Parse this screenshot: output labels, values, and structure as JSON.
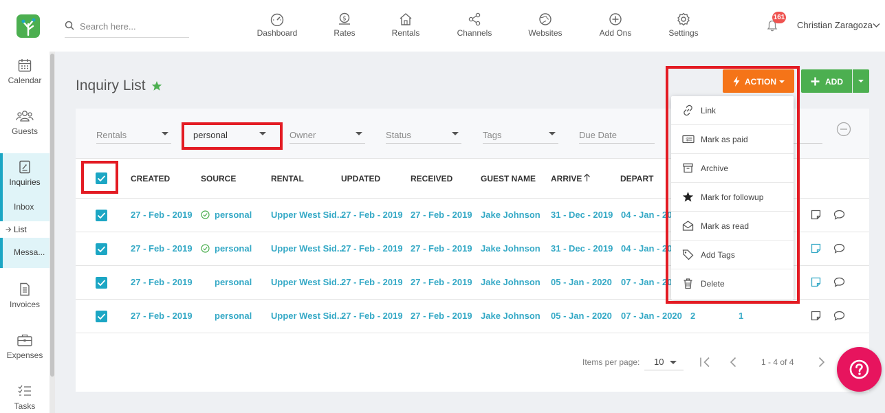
{
  "header": {
    "search_placeholder": "Search here...",
    "nav": [
      {
        "label": "Dashboard",
        "icon": "dashboard-icon"
      },
      {
        "label": "Rates",
        "icon": "rates-icon"
      },
      {
        "label": "Rentals",
        "icon": "home-icon"
      },
      {
        "label": "Channels",
        "icon": "share-icon"
      },
      {
        "label": "Websites",
        "icon": "globe-icon"
      },
      {
        "label": "Add Ons",
        "icon": "plus-circle-icon"
      },
      {
        "label": "Settings",
        "icon": "gear-icon"
      }
    ],
    "notification_count": "161",
    "user_name": "Christian Zaragoza"
  },
  "sidebar": {
    "items": [
      {
        "label": "Calendar",
        "icon": "calendar-icon"
      },
      {
        "label": "Guests",
        "icon": "guests-icon"
      },
      {
        "label": "Inquiries",
        "icon": "inquiries-icon"
      },
      {
        "label": "Invoices",
        "icon": "invoice-icon"
      },
      {
        "label": "Expenses",
        "icon": "briefcase-icon"
      },
      {
        "label": "Tasks",
        "icon": "tasks-icon"
      }
    ],
    "sub_items": [
      "Inbox",
      "List",
      "Messa..."
    ]
  },
  "page": {
    "title": "Inquiry List",
    "action_label": "ACTION",
    "add_label": "ADD"
  },
  "filters": [
    {
      "label": "Rentals"
    },
    {
      "label": "personal"
    },
    {
      "label": "Owner"
    },
    {
      "label": "Status"
    },
    {
      "label": "Tags"
    },
    {
      "label": "Due Date"
    }
  ],
  "table": {
    "columns": [
      "CREATED",
      "SOURCE",
      "RENTAL",
      "UPDATED",
      "RECEIVED",
      "GUEST NAME",
      "ARRIVE",
      "DEPART"
    ],
    "rows": [
      {
        "created": "27 - Feb - 2019",
        "source": "personal",
        "rental": "Upper West Sid...",
        "updated": "27 - Feb - 2019",
        "received": "27 - Feb - 2019",
        "guest": "Jake Johnson",
        "arrive": "31 - Dec - 2019",
        "depart": "04 - Jan - 20",
        "extra1": "",
        "extra2": ""
      },
      {
        "created": "27 - Feb - 2019",
        "source": "personal",
        "rental": "Upper West Sid...",
        "updated": "27 - Feb - 2019",
        "received": "27 - Feb - 2019",
        "guest": "Jake Johnson",
        "arrive": "31 - Dec - 2019",
        "depart": "04 - Jan - 20",
        "extra1": "",
        "extra2": ""
      },
      {
        "created": "27 - Feb - 2019",
        "source": "personal",
        "rental": "Upper West Sid...",
        "updated": "27 - Feb - 2019",
        "received": "27 - Feb - 2019",
        "guest": "Jake Johnson",
        "arrive": "05 - Jan - 2020",
        "depart": "07 - Jan - 20",
        "extra1": "",
        "extra2": ""
      },
      {
        "created": "27 - Feb - 2019",
        "source": "personal",
        "rental": "Upper West Sid...",
        "updated": "27 - Feb - 2019",
        "received": "27 - Feb - 2019",
        "guest": "Jake Johnson",
        "arrive": "05 - Jan - 2020",
        "depart": "07 - Jan - 2020",
        "extra1": "2",
        "extra2": "1"
      }
    ]
  },
  "pagination": {
    "items_per_page_label": "Items per page:",
    "items_per_page": "10",
    "range": "1 - 4 of 4"
  },
  "action_menu": [
    {
      "label": "Link",
      "icon": "link-icon"
    },
    {
      "label": "Mark as paid",
      "icon": "cash-icon"
    },
    {
      "label": "Archive",
      "icon": "archive-icon"
    },
    {
      "label": "Mark for followup",
      "icon": "star-icon"
    },
    {
      "label": "Mark as read",
      "icon": "envelope-open-icon"
    },
    {
      "label": "Add Tags",
      "icon": "tag-icon"
    },
    {
      "label": "Delete",
      "icon": "trash-icon"
    }
  ],
  "colors": {
    "accent": "#35a9c6",
    "action": "#f57418",
    "add": "#4caf50",
    "highlight": "#e31b23",
    "help": "#e7145e"
  }
}
